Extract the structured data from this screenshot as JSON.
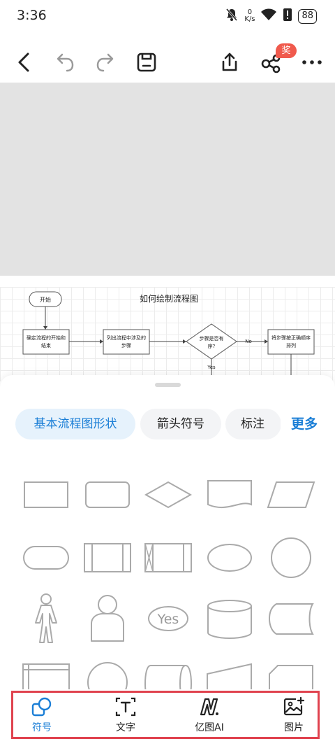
{
  "status_bar": {
    "time": "3:36",
    "net_speed_value": "0",
    "net_speed_unit": "K/s",
    "battery": "88",
    "icons": [
      "mute-bell-icon",
      "wifi-icon",
      "alert-icon",
      "battery-icon"
    ]
  },
  "toolbar": {
    "icons": [
      "back-icon",
      "undo-icon",
      "redo-icon",
      "save-icon",
      "share-upload-icon",
      "collaborate-icon",
      "more-icon"
    ],
    "badge": "奖"
  },
  "diagram": {
    "title": "如何绘制流程图",
    "start": "开始",
    "step1_line1": "确定流程的开始和",
    "step1_line2": "结束",
    "step2_line1": "列出流程中涉及的",
    "step2_line2": "步骤",
    "decision_line1": "步骤是否有",
    "decision_line2": "序?",
    "no_label": "No",
    "yes_label": "Yes",
    "step3_line1": "将步骤按正确顺序",
    "step3_line2": "排列"
  },
  "categories": {
    "tabs": [
      {
        "label": "基本流程图形状",
        "active": true
      },
      {
        "label": "箭头符号",
        "active": false
      },
      {
        "label": "标注",
        "active": false
      }
    ],
    "more": "更多"
  },
  "shapes": {
    "yes_text": "Yes",
    "items": [
      "rectangle",
      "rounded-rectangle",
      "diamond",
      "document",
      "parallelogram",
      "terminator",
      "predefined-process",
      "stored-data-process",
      "ellipse",
      "circle",
      "actor",
      "user",
      "yes-ellipse",
      "database",
      "stored-data",
      "internal-storage",
      "circle-partial",
      "cylinder-horizontal",
      "manual-input",
      "card"
    ]
  },
  "bottom_nav": {
    "items": [
      {
        "label": "符号",
        "icon": "shapes-icon",
        "active": true
      },
      {
        "label": "文字",
        "icon": "text-icon",
        "active": false
      },
      {
        "label": "亿图AI",
        "icon": "ai-icon",
        "active": false
      },
      {
        "label": "图片",
        "icon": "image-add-icon",
        "active": false
      }
    ]
  },
  "colors": {
    "accent": "#1a7ed6",
    "chip_active_bg": "#e6f2fc",
    "badge": "#f05a4d",
    "highlight_frame": "#e0434f",
    "canvas_gray": "#e3e3e3"
  }
}
